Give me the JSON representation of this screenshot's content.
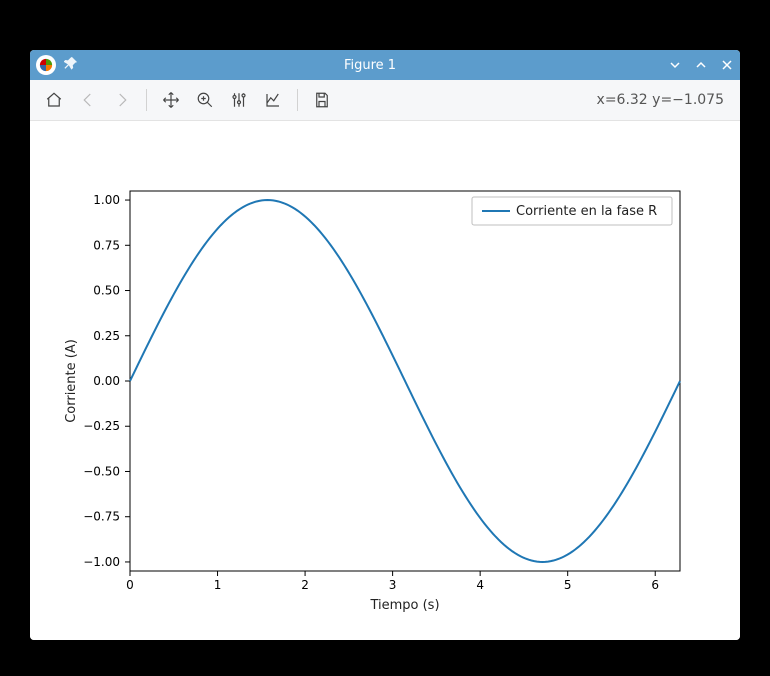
{
  "window": {
    "title": "Figure 1"
  },
  "toolbar": {
    "home": "home-icon",
    "back": "back-icon",
    "forward": "forward-icon",
    "pan": "pan-icon",
    "zoom": "zoom-icon",
    "subplots": "subplots-icon",
    "axes": "axes-icon",
    "save": "save-icon",
    "coord": "x=6.32 y=−1.075"
  },
  "chart_data": {
    "type": "line",
    "title": "",
    "xlabel": "Tiempo (s)",
    "ylabel": "Corriente (A)",
    "xlim": [
      0,
      6.283
    ],
    "ylim": [
      -1.05,
      1.05
    ],
    "xticks": [
      0,
      1,
      2,
      3,
      4,
      5,
      6
    ],
    "yticks": [
      -1.0,
      -0.75,
      -0.5,
      -0.25,
      0.0,
      0.25,
      0.5,
      0.75,
      1.0
    ],
    "series": [
      {
        "name": "Corriente en la fase R",
        "color": "#1f77b4",
        "x": [
          0,
          0.314,
          0.628,
          0.942,
          1.257,
          1.571,
          1.885,
          2.199,
          2.513,
          2.827,
          3.142,
          3.456,
          3.77,
          4.084,
          4.398,
          4.712,
          5.027,
          5.341,
          5.655,
          5.969,
          6.283
        ],
        "y": [
          0.0,
          0.309,
          0.588,
          0.809,
          0.951,
          1.0,
          0.951,
          0.809,
          0.588,
          0.309,
          0.0,
          -0.309,
          -0.588,
          -0.809,
          -0.951,
          -1.0,
          -0.951,
          -0.809,
          -0.588,
          -0.309,
          0.0
        ]
      }
    ],
    "legend": {
      "position": "upper right"
    }
  }
}
